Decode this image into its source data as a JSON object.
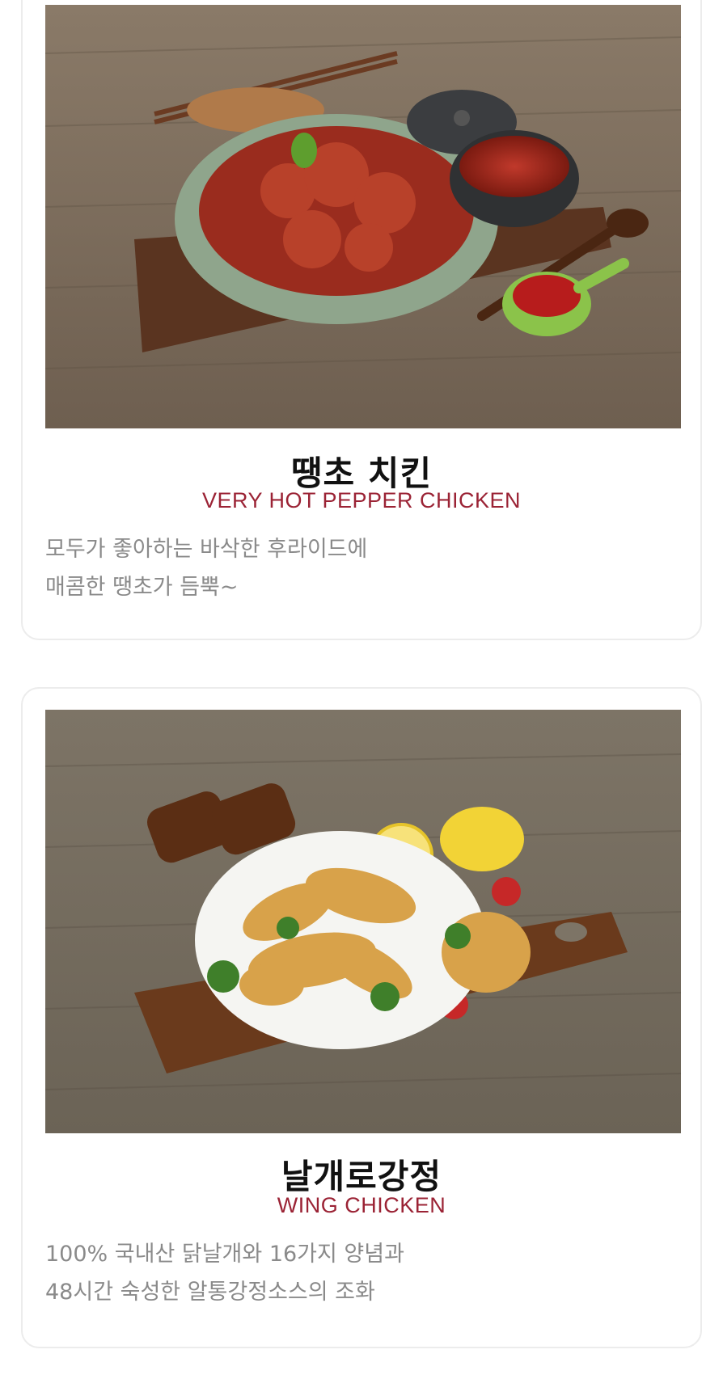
{
  "menu_items": [
    {
      "title": "땡초 치킨",
      "subtitle": "VERY HOT PEPPER CHICKEN",
      "description": [
        "모두가 좋아하는 바삭한 후라이드에",
        "매콤한 땡초가 듬뿍~"
      ],
      "photo": "spicy-chicken-photo"
    },
    {
      "title": "날개로강정",
      "subtitle": "WING CHICKEN",
      "description": [
        "100% 국내산 닭날개와 16가지 양념과",
        "48시간 숙성한 알통강정소스의 조화"
      ],
      "photo": "wing-chicken-photo"
    }
  ],
  "colors": {
    "subtitle": "#9b2335",
    "description": "#8a8a8a",
    "card_border": "#ececec"
  }
}
